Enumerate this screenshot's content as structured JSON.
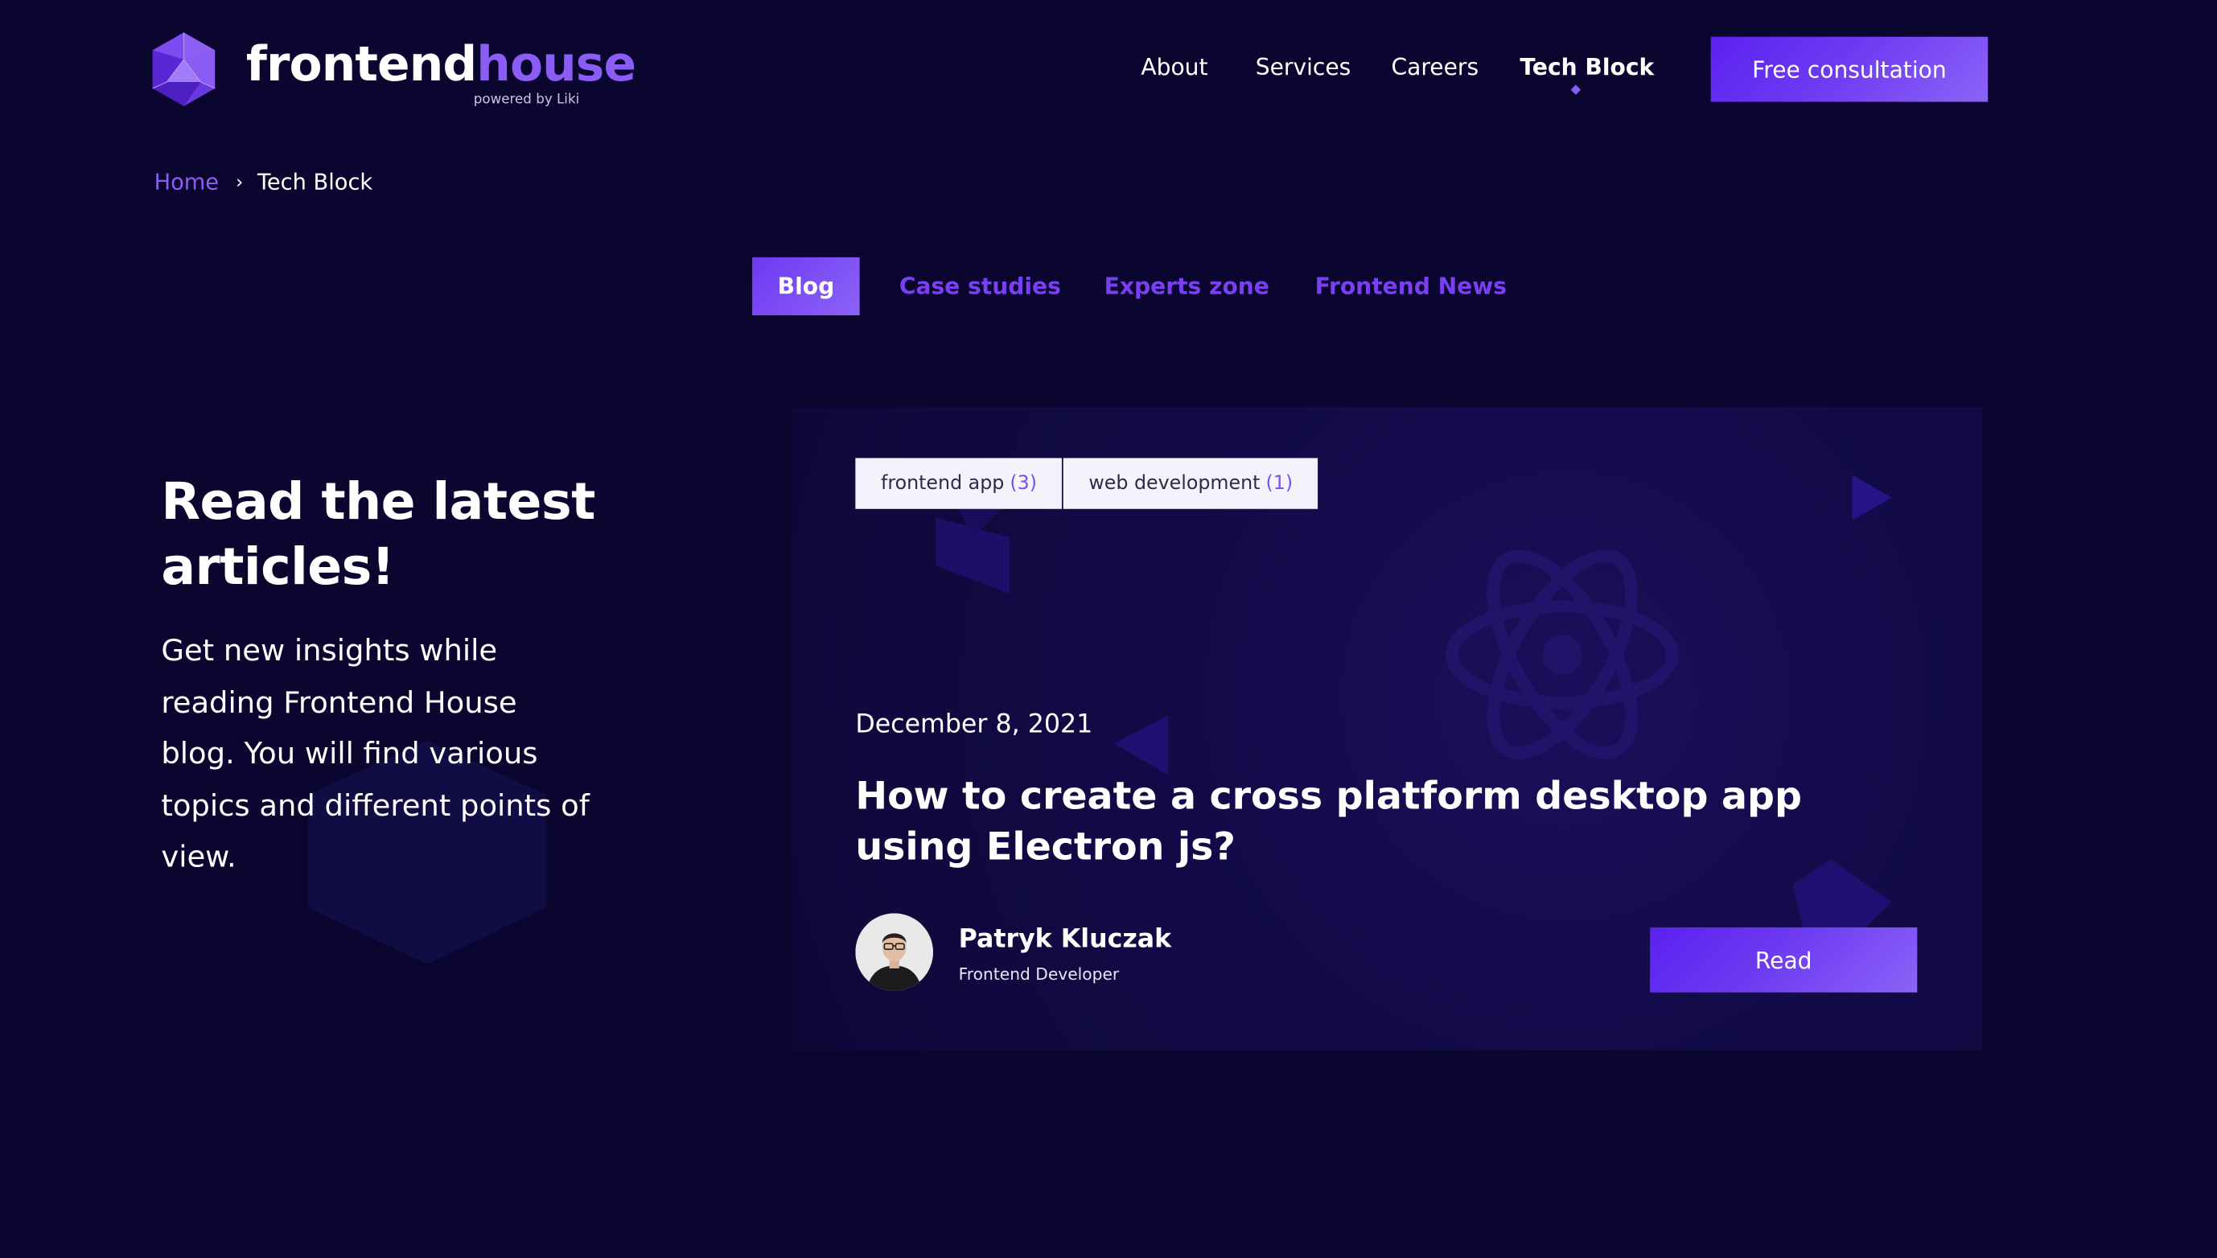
{
  "brand": {
    "name_part1": "frontend",
    "name_part2": "house",
    "tagline": "powered by Liki"
  },
  "nav": {
    "items": [
      {
        "label": "About"
      },
      {
        "label": "Services"
      },
      {
        "label": "Careers"
      },
      {
        "label": "Tech Block",
        "active": true
      }
    ],
    "cta_label": "Free consultation"
  },
  "breadcrumb": {
    "home": "Home",
    "separator": "›",
    "current": "Tech Block"
  },
  "tabs": [
    {
      "label": "Blog",
      "active": true
    },
    {
      "label": "Case studies"
    },
    {
      "label": "Experts zone"
    },
    {
      "label": "Frontend News"
    }
  ],
  "intro": {
    "title": "Read the latest articles!",
    "text": "Get new insights while reading Frontend House blog. You will find various topics and different points of view."
  },
  "featured_post": {
    "tags": [
      {
        "label": "frontend app",
        "count": "(3)"
      },
      {
        "label": "web development",
        "count": "(1)"
      }
    ],
    "date": "December 8, 2021",
    "title": "How to create a cross platform desktop app using Electron js?",
    "author": {
      "name": "Patryk Kluczak",
      "role": "Frontend Developer"
    },
    "read_label": "Read"
  },
  "colors": {
    "background": "#0a0630",
    "accent": "#7b3ff2",
    "accent_light": "#8c63f7",
    "card": "#130b4a",
    "tag_bg": "#f4f3fb"
  },
  "icons": [
    "logo-icon",
    "chevron-right-icon",
    "react-atom-icon",
    "avatar-photo"
  ]
}
